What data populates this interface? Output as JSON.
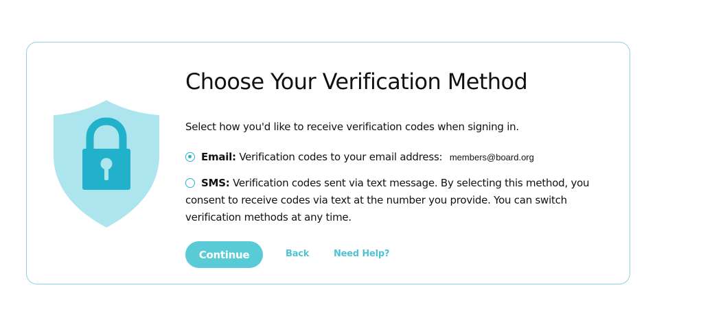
{
  "dialog": {
    "title": "Choose Your Verification Method",
    "subtitle": "Select how you'd like to receive verification codes when signing in.",
    "icon": "shield-lock-icon",
    "colors": {
      "accent": "#58cbd6",
      "border": "#8ad4df",
      "shield": "#ade5ee",
      "lock": "#22b1ca"
    }
  },
  "options": {
    "email": {
      "name": "Email:",
      "description": "Verification codes to your email address:",
      "address": "members@board.org",
      "selected": true
    },
    "sms": {
      "name": "SMS:",
      "description": "Verification codes sent via text message. By selecting this method, you consent to receive codes via text at the number you provide. You can switch verification methods at any time.",
      "selected": false
    }
  },
  "actions": {
    "continue_label": "Continue",
    "back_label": "Back",
    "help_label": "Need Help?"
  }
}
